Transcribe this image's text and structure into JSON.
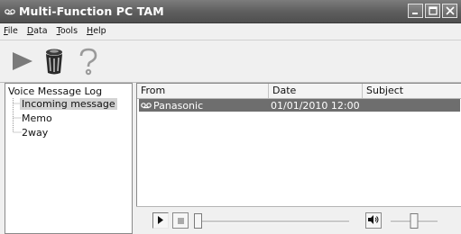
{
  "window": {
    "title": "Multi-Function PC TAM"
  },
  "menu": [
    {
      "prefix": "",
      "underlined": "F",
      "rest": "ile"
    },
    {
      "prefix": "",
      "underlined": "D",
      "rest": "ata"
    },
    {
      "prefix": "",
      "underlined": "T",
      "rest": "ools"
    },
    {
      "prefix": "",
      "underlined": "H",
      "rest": "elp"
    }
  ],
  "toolbar": {
    "play_icon": "play-icon",
    "delete_icon": "trash-icon",
    "help_icon": "question-icon"
  },
  "tree": {
    "root": "Voice Message Log",
    "items": [
      "Incoming message",
      "Memo",
      "2way"
    ],
    "selected_index": 0
  },
  "list": {
    "columns": [
      "From",
      "Date",
      "Subject"
    ],
    "rows": [
      {
        "from": "Panasonic",
        "date": "01/01/2010 12:00",
        "subject": "",
        "icon": "tape-icon"
      }
    ]
  },
  "player": {
    "position_fraction": 0.0,
    "volume_fraction": 0.5
  },
  "colors": {
    "titlebar": "#5f5f5f",
    "selection": "#6e6e6e",
    "tree_selection": "#d3d3d3"
  }
}
